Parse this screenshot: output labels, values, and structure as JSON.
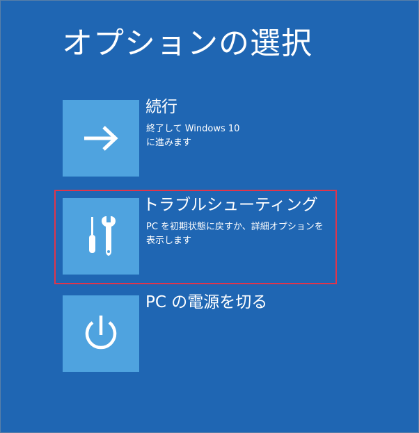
{
  "page": {
    "title": "オプションの選択"
  },
  "options": [
    {
      "id": "continue",
      "icon": "arrow-right-icon",
      "title": "続行",
      "description_lines": [
        "終了して Windows 10",
        "に進みます"
      ]
    },
    {
      "id": "troubleshoot",
      "icon": "tools-icon",
      "title": "トラブルシューティング",
      "description_lines": [
        "PC を初期状態に戻すか、詳細オプションを",
        "表示します"
      ],
      "highlighted": true
    },
    {
      "id": "power-off",
      "icon": "power-icon",
      "title": "PC の電源を切る",
      "description_lines": []
    }
  ],
  "colors": {
    "background": "#1f66b3",
    "tile": "#4fa3df",
    "highlight_border": "#e0354b",
    "text": "#ffffff"
  }
}
